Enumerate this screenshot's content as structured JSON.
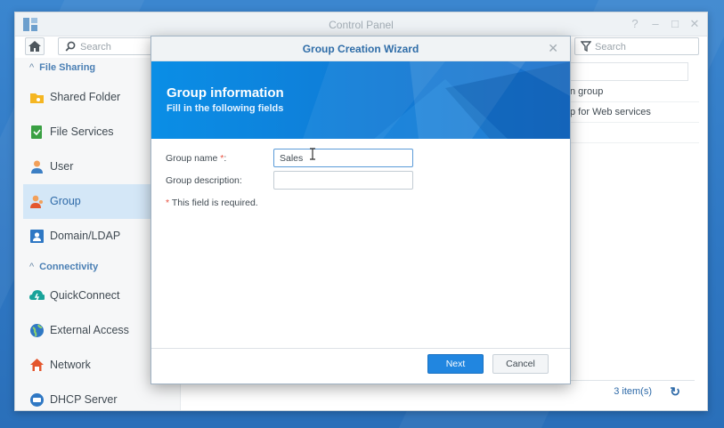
{
  "window": {
    "title": "Control Panel"
  },
  "toolbar": {
    "search_placeholder": "Search",
    "filter_placeholder": "Search"
  },
  "sidebar": {
    "sections": [
      {
        "label": "File Sharing"
      },
      {
        "label": "Connectivity"
      }
    ],
    "items": [
      {
        "label": "Shared Folder",
        "icon": "shared-folder-icon"
      },
      {
        "label": "File Services",
        "icon": "file-services-icon"
      },
      {
        "label": "User",
        "icon": "user-icon"
      },
      {
        "label": "Group",
        "icon": "group-icon",
        "active": true
      },
      {
        "label": "Domain/LDAP",
        "icon": "domain-ldap-icon"
      },
      {
        "label": "QuickConnect",
        "icon": "quickconnect-icon"
      },
      {
        "label": "External Access",
        "icon": "external-access-icon"
      },
      {
        "label": "Network",
        "icon": "network-icon"
      },
      {
        "label": "DHCP Server",
        "icon": "dhcp-server-icon"
      }
    ]
  },
  "background_list": {
    "rows": [
      "n group",
      "p for Web services",
      ""
    ],
    "count": "3 item(s)"
  },
  "dialog": {
    "title": "Group Creation Wizard",
    "banner_title": "Group information",
    "banner_subtitle": "Fill in the following fields",
    "fields": {
      "name_label": "Group name",
      "name_required_mark": "*",
      "name_suffix": ":",
      "name_value": "Sales",
      "description_label": "Group description:",
      "description_value": ""
    },
    "required_mark": "*",
    "required_note": "This field is required.",
    "next_label": "Next",
    "cancel_label": "Cancel"
  },
  "colors": {
    "accent": "#2186e0",
    "banner": "#0f7ed8",
    "desktop": "#3b86cf",
    "required": "#e8503f"
  }
}
